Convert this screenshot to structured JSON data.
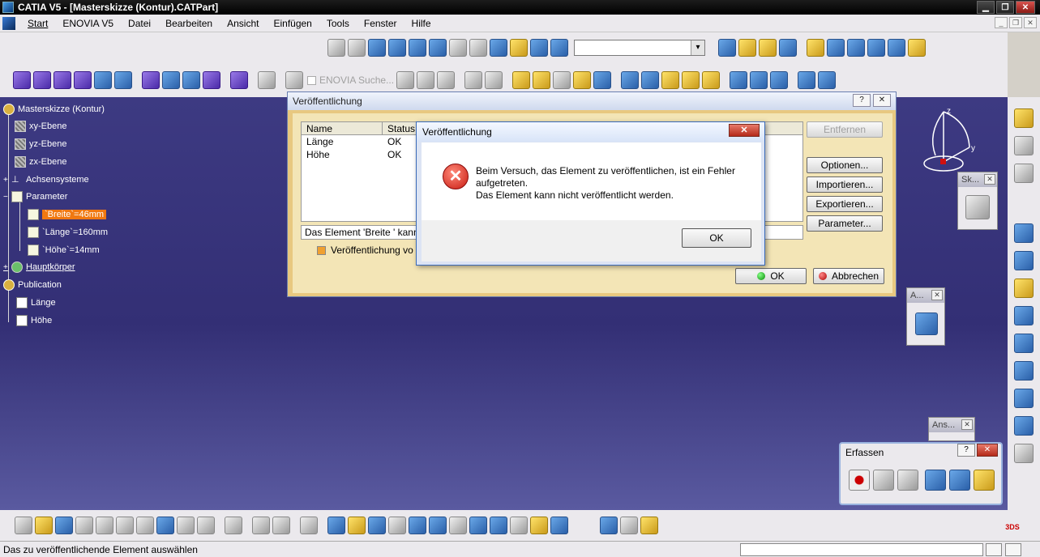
{
  "window": {
    "title": "CATIA V5 - [Masterskizze (Kontur).CATPart]"
  },
  "menu": [
    "Start",
    "ENOVIA V5",
    "Datei",
    "Bearbeiten",
    "Ansicht",
    "Einfügen",
    "Tools",
    "Fenster",
    "Hilfe"
  ],
  "toolbar": {
    "enovia_search": "ENOVIA Suche..."
  },
  "tree": {
    "root": "Masterskizze (Kontur)",
    "xy": "xy-Ebene",
    "yz": "yz-Ebene",
    "zx": "zx-Ebene",
    "axes": "Achsensysteme",
    "params": "Parameter",
    "breite": "`Breite`=46mm",
    "laenge": "`Länge`=160mm",
    "hoehe": "`Höhe`=14mm",
    "body": "Hauptkörper",
    "publication": "Publication",
    "pub_laenge": "Länge",
    "pub_hoehe": "Höhe"
  },
  "compass": {
    "z": "z",
    "y": "y"
  },
  "mini_toolbars": {
    "sketch": "Sk...",
    "ansicht1": "A...",
    "ansicht2": "Ans..."
  },
  "erfassen": {
    "title": "Erfassen"
  },
  "publish_dialog": {
    "title": "Veröffentlichung",
    "columns": [
      "Name",
      "Status"
    ],
    "rows": [
      {
        "name": "Länge",
        "status": "OK"
      },
      {
        "name": "Höhe",
        "status": "OK"
      }
    ],
    "status_text": "Das Element 'Breite ' kann",
    "checkbox_label": "Veröffentlichung vo",
    "buttons": {
      "remove": "Entfernen",
      "options": "Optionen...",
      "import": "Importieren...",
      "export": "Exportieren...",
      "params": "Parameter..."
    },
    "ok": "OK",
    "cancel": "Abbrechen"
  },
  "error_dialog": {
    "title": "Veröffentlichung",
    "line1": "Beim Versuch, das Element zu veröffentlichen, ist ein Fehler aufgetreten.",
    "line2": "Das Element kann nicht veröffentlicht werden.",
    "ok": "OK"
  },
  "statusbar": {
    "text": "Das zu veröffentlichende Element auswählen"
  }
}
